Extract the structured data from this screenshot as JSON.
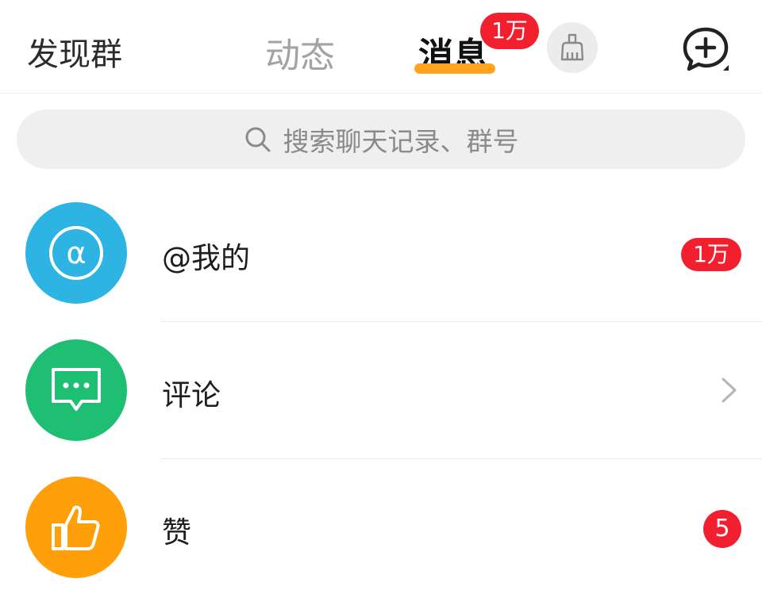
{
  "header": {
    "discover_group": "发现群",
    "tab_dynamic": "动态",
    "tab_messages": "消息",
    "tab_messages_badge": "1万",
    "clean_icon": "broom-icon",
    "add_icon": "chat-plus-icon"
  },
  "search": {
    "icon": "search-icon",
    "placeholder": "搜索聊天记录、群号"
  },
  "list": [
    {
      "icon": "at-icon",
      "label": "@我的",
      "badge": "1万",
      "color": "#2db4e2"
    },
    {
      "icon": "comment-icon",
      "label": "评论",
      "chevron": "chevron-right-icon",
      "color": "#1fbf73"
    },
    {
      "icon": "thumbs-up-icon",
      "label": "赞",
      "badge": "5",
      "color": "#ff9f0a"
    }
  ],
  "colors": {
    "accent_underline": "#ffa321",
    "badge_red": "#f2202e"
  }
}
